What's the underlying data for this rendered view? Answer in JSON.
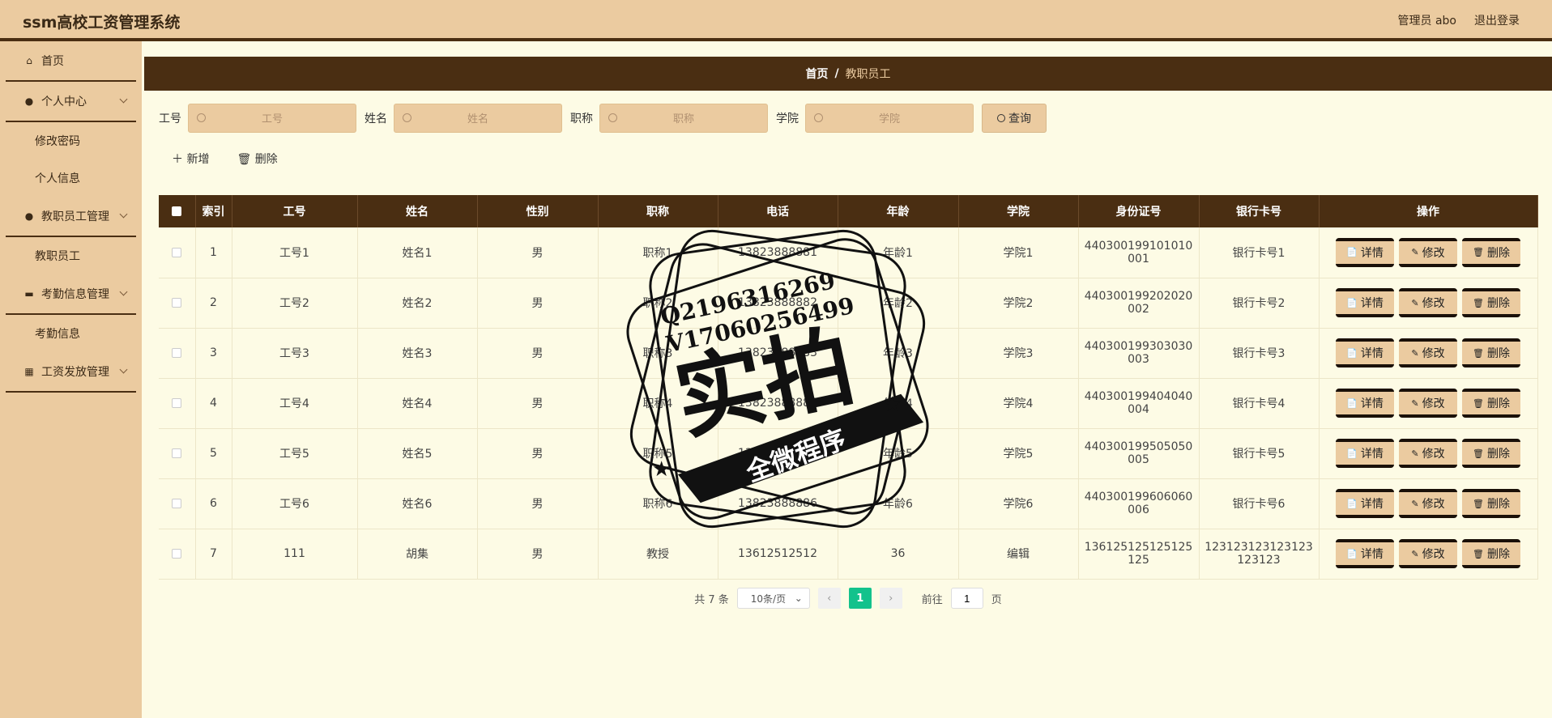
{
  "app": {
    "title": "ssm高校工资管理系统"
  },
  "header": {
    "user_label": "管理员 abo",
    "logout_label": "退出登录"
  },
  "sidebar": {
    "home": "首页",
    "personal": "个人中心",
    "personal_items": [
      "修改密码",
      "个人信息"
    ],
    "staff_mgmt": "教职员工管理",
    "staff_items": [
      "教职员工"
    ],
    "attendance_mgmt": "考勤信息管理",
    "attendance_items": [
      "考勤信息"
    ],
    "salary_mgmt": "工资发放管理"
  },
  "breadcrumb": {
    "home": "首页",
    "sep": "/",
    "current": "教职员工"
  },
  "search": {
    "fields": [
      {
        "label": "工号",
        "placeholder": "工号"
      },
      {
        "label": "姓名",
        "placeholder": "姓名"
      },
      {
        "label": "职称",
        "placeholder": "职称"
      },
      {
        "label": "学院",
        "placeholder": "学院"
      }
    ],
    "query_label": "查询"
  },
  "actions": {
    "add_label": "新增",
    "delete_label": "删除"
  },
  "table": {
    "headers": [
      "索引",
      "工号",
      "姓名",
      "性别",
      "职称",
      "电话",
      "年龄",
      "学院",
      "身份证号",
      "银行卡号",
      "操作"
    ],
    "rows": [
      [
        "1",
        "工号1",
        "姓名1",
        "男",
        "职称1",
        "13823888881",
        "年龄1",
        "学院1",
        "440300199101010001",
        "银行卡号1"
      ],
      [
        "2",
        "工号2",
        "姓名2",
        "男",
        "职称2",
        "13823888882",
        "年龄2",
        "学院2",
        "440300199202020002",
        "银行卡号2"
      ],
      [
        "3",
        "工号3",
        "姓名3",
        "男",
        "职称3",
        "13823888883",
        "年龄3",
        "学院3",
        "440300199303030003",
        "银行卡号3"
      ],
      [
        "4",
        "工号4",
        "姓名4",
        "男",
        "职称4",
        "13823888884",
        "年龄4",
        "学院4",
        "440300199404040004",
        "银行卡号4"
      ],
      [
        "5",
        "工号5",
        "姓名5",
        "男",
        "职称5",
        "13823888885",
        "年龄5",
        "学院5",
        "440300199505050005",
        "银行卡号5"
      ],
      [
        "6",
        "工号6",
        "姓名6",
        "男",
        "职称6",
        "13823888886",
        "年龄6",
        "学院6",
        "440300199606060006",
        "银行卡号6"
      ],
      [
        "7",
        "111",
        "胡集",
        "男",
        "教授",
        "13612512512",
        "36",
        "编辑",
        "136125125125125125",
        "123123123123123123123"
      ]
    ],
    "op_labels": {
      "detail": "详情",
      "edit": "修改",
      "delete": "删除"
    }
  },
  "pagination": {
    "total_label": "共 7 条",
    "page_size": "10条/页",
    "current_page": "1",
    "goto_label": "前往",
    "goto_value": "1",
    "page_suffix": "页"
  },
  "watermark": {
    "line1": "Q2196316269",
    "line2": "V17060256499",
    "main": "实拍",
    "banner": "全微程序"
  }
}
